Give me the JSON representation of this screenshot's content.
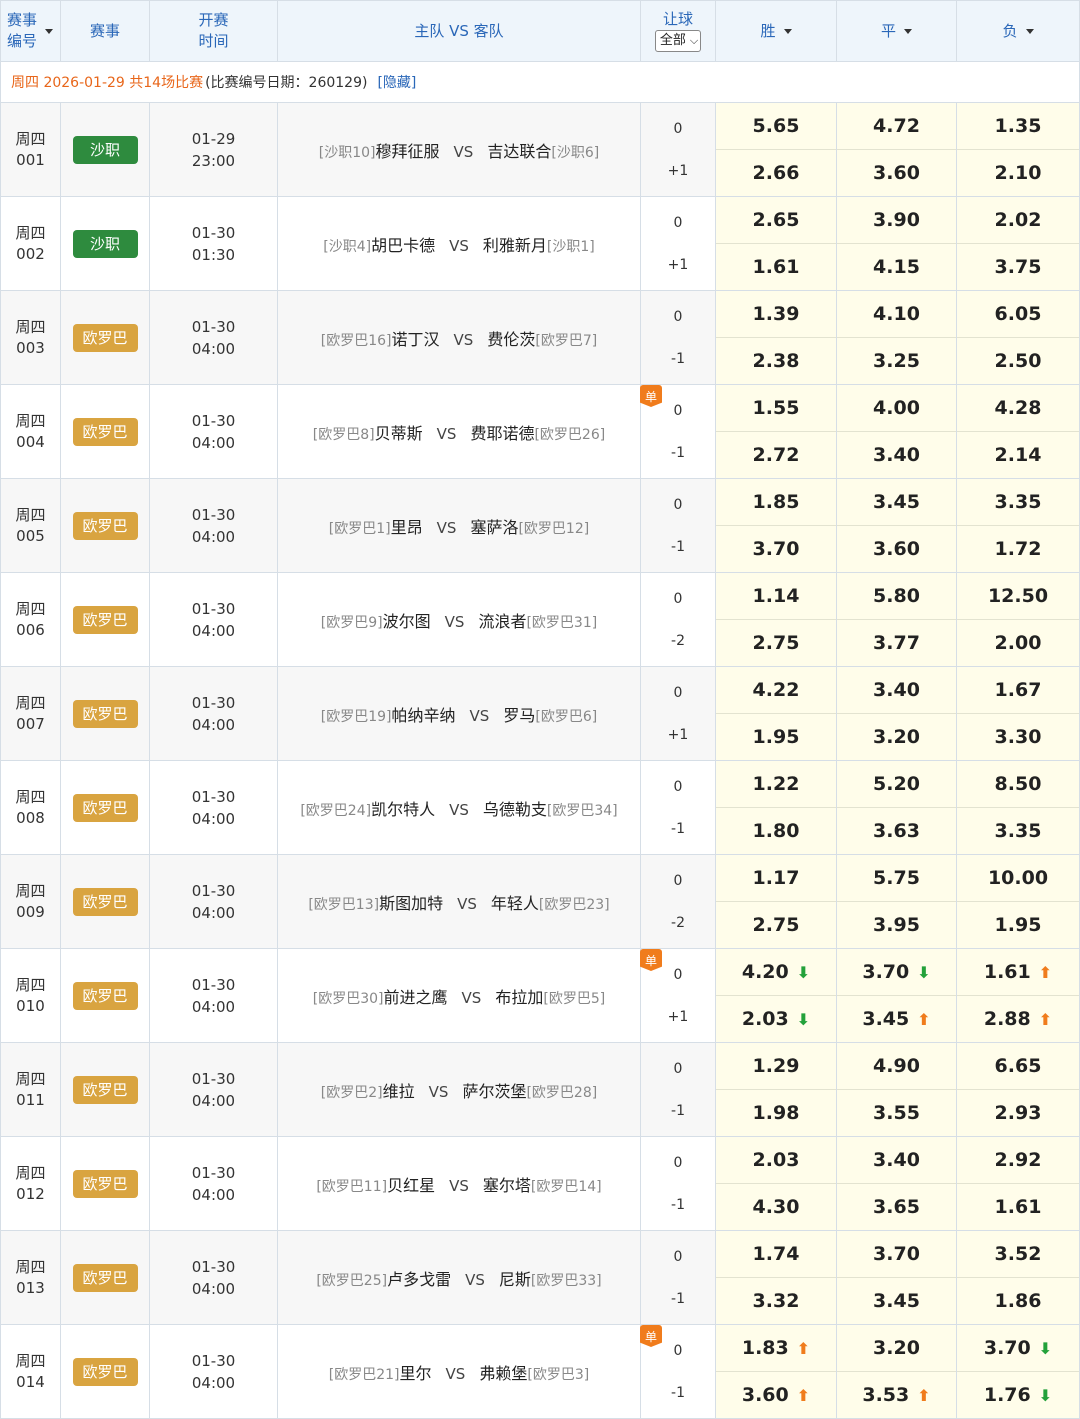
{
  "header": {
    "match_no_line1": "赛事",
    "match_no_line2": "编号",
    "league": "赛事",
    "time_line1": "开赛",
    "time_line2": "时间",
    "teams": "主队 VS 客队",
    "handicap": "让球",
    "handicap_select": "全部",
    "win": "胜",
    "draw": "平",
    "lose": "负"
  },
  "info": {
    "date_text": "周四 2026-01-29 共14场比赛",
    "meta_text": "(比赛编号日期：260129)",
    "hide_link": "[隐藏]"
  },
  "colors": {
    "league_saudi": "#2e8b3e",
    "league_europa": "#d9a440",
    "odds_bg": "#fffdea",
    "arrow_up": "#f07c1c",
    "arrow_down": "#23a13a"
  },
  "matches": [
    {
      "day": "周四",
      "no": "001",
      "league": "沙职",
      "league_color": "#2e8b3e",
      "date": "01-29",
      "time": "23:00",
      "home_rank": "[沙职10]",
      "home": "穆拜征服",
      "vs": "VS",
      "away": "吉达联合",
      "away_rank": "[沙职6]",
      "single": false,
      "h0": "0",
      "h1": "+1",
      "odds": [
        [
          "5.65",
          "",
          ""
        ],
        [
          "4.72",
          "",
          ""
        ],
        [
          "1.35",
          "",
          ""
        ],
        [
          "2.66",
          "",
          ""
        ],
        [
          "3.60",
          "",
          ""
        ],
        [
          "2.10",
          "",
          ""
        ]
      ]
    },
    {
      "day": "周四",
      "no": "002",
      "league": "沙职",
      "league_color": "#2e8b3e",
      "date": "01-30",
      "time": "01:30",
      "home_rank": "[沙职4]",
      "home": "胡巴卡德",
      "vs": "VS",
      "away": "利雅新月",
      "away_rank": "[沙职1]",
      "single": false,
      "h0": "0",
      "h1": "+1",
      "odds": [
        [
          "2.65",
          "",
          ""
        ],
        [
          "3.90",
          "",
          ""
        ],
        [
          "2.02",
          "",
          ""
        ],
        [
          "1.61",
          "",
          ""
        ],
        [
          "4.15",
          "",
          ""
        ],
        [
          "3.75",
          "",
          ""
        ]
      ]
    },
    {
      "day": "周四",
      "no": "003",
      "league": "欧罗巴",
      "league_color": "#d9a440",
      "date": "01-30",
      "time": "04:00",
      "home_rank": "[欧罗巴16]",
      "home": "诺丁汉",
      "vs": "VS",
      "away": "费伦茨",
      "away_rank": "[欧罗巴7]",
      "single": false,
      "h0": "0",
      "h1": "-1",
      "odds": [
        [
          "1.39",
          "",
          ""
        ],
        [
          "4.10",
          "",
          ""
        ],
        [
          "6.05",
          "",
          ""
        ],
        [
          "2.38",
          "",
          ""
        ],
        [
          "3.25",
          "",
          ""
        ],
        [
          "2.50",
          "",
          ""
        ]
      ]
    },
    {
      "day": "周四",
      "no": "004",
      "league": "欧罗巴",
      "league_color": "#d9a440",
      "date": "01-30",
      "time": "04:00",
      "home_rank": "[欧罗巴8]",
      "home": "贝蒂斯",
      "vs": "VS",
      "away": "费耶诺德",
      "away_rank": "[欧罗巴26]",
      "single": true,
      "single_label": "单",
      "h0": "0",
      "h1": "-1",
      "odds": [
        [
          "1.55",
          "",
          ""
        ],
        [
          "4.00",
          "",
          ""
        ],
        [
          "4.28",
          "",
          ""
        ],
        [
          "2.72",
          "",
          ""
        ],
        [
          "3.40",
          "",
          ""
        ],
        [
          "2.14",
          "",
          ""
        ]
      ]
    },
    {
      "day": "周四",
      "no": "005",
      "league": "欧罗巴",
      "league_color": "#d9a440",
      "date": "01-30",
      "time": "04:00",
      "home_rank": "[欧罗巴1]",
      "home": "里昂",
      "vs": "VS",
      "away": "塞萨洛",
      "away_rank": "[欧罗巴12]",
      "single": false,
      "h0": "0",
      "h1": "-1",
      "odds": [
        [
          "1.85",
          "",
          ""
        ],
        [
          "3.45",
          "",
          ""
        ],
        [
          "3.35",
          "",
          ""
        ],
        [
          "3.70",
          "",
          ""
        ],
        [
          "3.60",
          "",
          ""
        ],
        [
          "1.72",
          "",
          ""
        ]
      ]
    },
    {
      "day": "周四",
      "no": "006",
      "league": "欧罗巴",
      "league_color": "#d9a440",
      "date": "01-30",
      "time": "04:00",
      "home_rank": "[欧罗巴9]",
      "home": "波尔图",
      "vs": "VS",
      "away": "流浪者",
      "away_rank": "[欧罗巴31]",
      "single": false,
      "h0": "0",
      "h1": "-2",
      "odds": [
        [
          "1.14",
          "",
          ""
        ],
        [
          "5.80",
          "",
          ""
        ],
        [
          "12.50",
          "",
          ""
        ],
        [
          "2.75",
          "",
          ""
        ],
        [
          "3.77",
          "",
          ""
        ],
        [
          "2.00",
          "",
          ""
        ]
      ]
    },
    {
      "day": "周四",
      "no": "007",
      "league": "欧罗巴",
      "league_color": "#d9a440",
      "date": "01-30",
      "time": "04:00",
      "home_rank": "[欧罗巴19]",
      "home": "帕纳辛纳",
      "vs": "VS",
      "away": "罗马",
      "away_rank": "[欧罗巴6]",
      "single": false,
      "h0": "0",
      "h1": "+1",
      "odds": [
        [
          "4.22",
          "",
          ""
        ],
        [
          "3.40",
          "",
          ""
        ],
        [
          "1.67",
          "",
          ""
        ],
        [
          "1.95",
          "",
          ""
        ],
        [
          "3.20",
          "",
          ""
        ],
        [
          "3.30",
          "",
          ""
        ]
      ]
    },
    {
      "day": "周四",
      "no": "008",
      "league": "欧罗巴",
      "league_color": "#d9a440",
      "date": "01-30",
      "time": "04:00",
      "home_rank": "[欧罗巴24]",
      "home": "凯尔特人",
      "vs": "VS",
      "away": "乌德勒支",
      "away_rank": "[欧罗巴34]",
      "single": false,
      "h0": "0",
      "h1": "-1",
      "odds": [
        [
          "1.22",
          "",
          ""
        ],
        [
          "5.20",
          "",
          ""
        ],
        [
          "8.50",
          "",
          ""
        ],
        [
          "1.80",
          "",
          ""
        ],
        [
          "3.63",
          "",
          ""
        ],
        [
          "3.35",
          "",
          ""
        ]
      ]
    },
    {
      "day": "周四",
      "no": "009",
      "league": "欧罗巴",
      "league_color": "#d9a440",
      "date": "01-30",
      "time": "04:00",
      "home_rank": "[欧罗巴13]",
      "home": "斯图加特",
      "vs": "VS",
      "away": "年轻人",
      "away_rank": "[欧罗巴23]",
      "single": false,
      "h0": "0",
      "h1": "-2",
      "odds": [
        [
          "1.17",
          "",
          ""
        ],
        [
          "5.75",
          "",
          ""
        ],
        [
          "10.00",
          "",
          ""
        ],
        [
          "2.75",
          "",
          ""
        ],
        [
          "3.95",
          "",
          ""
        ],
        [
          "1.95",
          "",
          ""
        ]
      ]
    },
    {
      "day": "周四",
      "no": "010",
      "league": "欧罗巴",
      "league_color": "#d9a440",
      "date": "01-30",
      "time": "04:00",
      "home_rank": "[欧罗巴30]",
      "home": "前进之鹰",
      "vs": "VS",
      "away": "布拉加",
      "away_rank": "[欧罗巴5]",
      "single": true,
      "single_label": "单",
      "h0": "0",
      "h1": "+1",
      "odds": [
        [
          "4.20",
          "down",
          "arrow-down-icon"
        ],
        [
          "3.70",
          "down",
          "arrow-down-icon"
        ],
        [
          "1.61",
          "up",
          "arrow-up-icon"
        ],
        [
          "2.03",
          "down",
          "arrow-down-icon"
        ],
        [
          "3.45",
          "up",
          "arrow-up-icon"
        ],
        [
          "2.88",
          "up",
          "arrow-up-icon"
        ]
      ]
    },
    {
      "day": "周四",
      "no": "011",
      "league": "欧罗巴",
      "league_color": "#d9a440",
      "date": "01-30",
      "time": "04:00",
      "home_rank": "[欧罗巴2]",
      "home": "维拉",
      "vs": "VS",
      "away": "萨尔茨堡",
      "away_rank": "[欧罗巴28]",
      "single": false,
      "h0": "0",
      "h1": "-1",
      "odds": [
        [
          "1.29",
          "",
          ""
        ],
        [
          "4.90",
          "",
          ""
        ],
        [
          "6.65",
          "",
          ""
        ],
        [
          "1.98",
          "",
          ""
        ],
        [
          "3.55",
          "",
          ""
        ],
        [
          "2.93",
          "",
          ""
        ]
      ]
    },
    {
      "day": "周四",
      "no": "012",
      "league": "欧罗巴",
      "league_color": "#d9a440",
      "date": "01-30",
      "time": "04:00",
      "home_rank": "[欧罗巴11]",
      "home": "贝红星",
      "vs": "VS",
      "away": "塞尔塔",
      "away_rank": "[欧罗巴14]",
      "single": false,
      "h0": "0",
      "h1": "-1",
      "odds": [
        [
          "2.03",
          "",
          ""
        ],
        [
          "3.40",
          "",
          ""
        ],
        [
          "2.92",
          "",
          ""
        ],
        [
          "4.30",
          "",
          ""
        ],
        [
          "3.65",
          "",
          ""
        ],
        [
          "1.61",
          "",
          ""
        ]
      ]
    },
    {
      "day": "周四",
      "no": "013",
      "league": "欧罗巴",
      "league_color": "#d9a440",
      "date": "01-30",
      "time": "04:00",
      "home_rank": "[欧罗巴25]",
      "home": "卢多戈雷",
      "vs": "VS",
      "away": "尼斯",
      "away_rank": "[欧罗巴33]",
      "single": false,
      "h0": "0",
      "h1": "-1",
      "odds": [
        [
          "1.74",
          "",
          ""
        ],
        [
          "3.70",
          "",
          ""
        ],
        [
          "3.52",
          "",
          ""
        ],
        [
          "3.32",
          "",
          ""
        ],
        [
          "3.45",
          "",
          ""
        ],
        [
          "1.86",
          "",
          ""
        ]
      ]
    },
    {
      "day": "周四",
      "no": "014",
      "league": "欧罗巴",
      "league_color": "#d9a440",
      "date": "01-30",
      "time": "04:00",
      "home_rank": "[欧罗巴21]",
      "home": "里尔",
      "vs": "VS",
      "away": "弗赖堡",
      "away_rank": "[欧罗巴3]",
      "single": true,
      "single_label": "单",
      "h0": "0",
      "h1": "-1",
      "odds": [
        [
          "1.83",
          "up",
          "arrow-up-icon"
        ],
        [
          "3.20",
          "",
          ""
        ],
        [
          "3.70",
          "down",
          "arrow-down-icon"
        ],
        [
          "3.60",
          "up",
          "arrow-up-icon"
        ],
        [
          "3.53",
          "up",
          "arrow-up-icon"
        ],
        [
          "1.76",
          "down",
          "arrow-down-icon"
        ]
      ]
    }
  ]
}
